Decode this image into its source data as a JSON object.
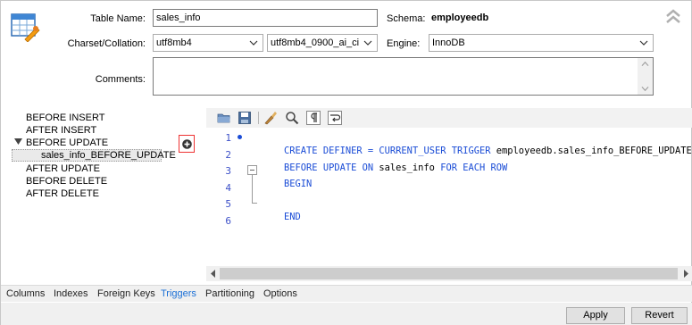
{
  "header": {
    "table_name_label": "Table Name:",
    "table_name_value": "sales_info",
    "schema_label": "Schema:",
    "schema_value": "employeedb",
    "charset_label": "Charset/Collation:",
    "charset_value": "utf8mb4",
    "collation_value": "utf8mb4_0900_ai_ci",
    "engine_label": "Engine:",
    "engine_value": "InnoDB",
    "comments_label": "Comments:",
    "comments_value": ""
  },
  "triggers_tree": {
    "items": [
      {
        "label": "BEFORE INSERT"
      },
      {
        "label": "AFTER INSERT"
      },
      {
        "label": "BEFORE UPDATE",
        "expanded": true,
        "children": [
          {
            "label": "sales_info_BEFORE_UPDATE",
            "selected": true
          }
        ]
      },
      {
        "label": "AFTER UPDATE"
      },
      {
        "label": "BEFORE DELETE"
      },
      {
        "label": "AFTER DELETE"
      }
    ]
  },
  "editor": {
    "toolbar": [
      "open-folder-icon",
      "save-icon",
      "beautify-icon",
      "find-icon",
      "invisible-chars-icon",
      "word-wrap-icon"
    ],
    "line_numbers": [
      "1",
      "2",
      "3",
      "4",
      "5",
      "6"
    ],
    "lines": {
      "l1_kw1": "CREATE DEFINER",
      "l1_op": " = ",
      "l1_kw2": "CURRENT_USER TRIGGER",
      "l1_rest": " employeedb.sales_info_BEFORE_UPDATE",
      "l2_kw1": "BEFORE UPDATE ON",
      "l2_mid": " sales_info ",
      "l2_kw2": "FOR EACH ROW",
      "l3": "BEGIN",
      "l5": "END"
    }
  },
  "tabs": [
    "Columns",
    "Indexes",
    "Foreign Keys",
    "Triggers",
    "Partitioning",
    "Options"
  ],
  "active_tab": "Triggers",
  "buttons": {
    "apply": "Apply",
    "revert": "Revert"
  },
  "colors": {
    "keyword": "#1a4cd6",
    "active_tab": "#1a6fd6",
    "line_number": "#3c50c8"
  }
}
